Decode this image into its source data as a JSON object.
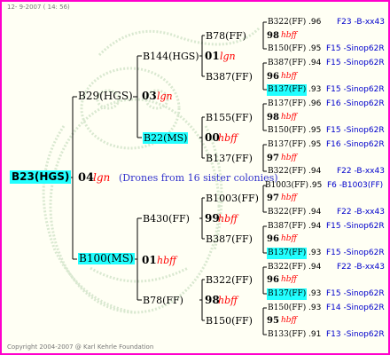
{
  "header": {
    "date": "12- 9-2007 ( 14: 56)"
  },
  "footer": {
    "copyright": "Copyright 2004-2007 @ Karl Kehrle Foundation"
  },
  "root": {
    "id": "B23(HGS)",
    "year": "04",
    "code": "lgn",
    "drones": "(Drones from 16 sister colonies)"
  },
  "gen1": {
    "top": {
      "id": "B29(HGS)",
      "year": "03",
      "code": "lgn"
    },
    "bottom": {
      "id": "B100(MS)",
      "year": "01",
      "code": "hbff"
    }
  },
  "gen2": [
    {
      "id": "B144(HGS)",
      "year": "01",
      "code": "lgn"
    },
    {
      "id": "B22(MS)",
      "year": "00",
      "code": "hbff"
    },
    {
      "id": "B430(FF)",
      "year": "99",
      "code": "hbff"
    },
    {
      "id": "B78(FF)",
      "year": "98",
      "code": "hbff"
    }
  ],
  "gen3": [
    {
      "id": "B78(FF)",
      "year": "98",
      "code": "hbff"
    },
    {
      "id": "B387(FF)",
      "year": "96",
      "code": "hbff"
    },
    {
      "id": "B155(FF)",
      "year": "98",
      "code": "hbff"
    },
    {
      "id": "B137(FF)",
      "year": "97",
      "code": "hbff"
    },
    {
      "id": "B1003(FF)",
      "year": "97",
      "code": "hbff"
    },
    {
      "id": "B387(FF)",
      "year": "96",
      "code": "hbff"
    },
    {
      "id": "B322(FF)",
      "year": "96",
      "code": "hbff"
    },
    {
      "id": "B150(FF)",
      "year": "95",
      "code": "hbff"
    }
  ],
  "gen4": [
    {
      "id": "B322(FF)",
      "score": ".96",
      "ref": "F23 -B-xx43"
    },
    {
      "id": "B150(FF)",
      "score": ".95",
      "ref": "F15 -Sinop62R"
    },
    {
      "id": "B387(FF)",
      "score": ".94",
      "ref": "F15 -Sinop62R"
    },
    {
      "id": "B137(FF)",
      "score": ".93",
      "ref": "F15 -Sinop62R"
    },
    {
      "id": "B137(FF)",
      "score": ".96",
      "ref": "F16 -Sinop62R"
    },
    {
      "id": "B150(FF)",
      "score": ".95",
      "ref": "F15 -Sinop62R"
    },
    {
      "id": "B137(FF)",
      "score": ".95",
      "ref": "F16 -Sinop62R"
    },
    {
      "id": "B322(FF)",
      "score": ".94",
      "ref": "F22 -B-xx43"
    },
    {
      "id": "B1003(FF)",
      "score": ".95",
      "ref": "F6 -B1003(FF)"
    },
    {
      "id": "B322(FF)",
      "score": ".94",
      "ref": "F22 -B-xx43"
    },
    {
      "id": "B387(FF)",
      "score": ".94",
      "ref": "F15 -Sinop62R"
    },
    {
      "id": "B137(FF)",
      "score": ".93",
      "ref": "F15 -Sinop62R"
    },
    {
      "id": "B322(FF)",
      "score": ".94",
      "ref": "F22 -B-xx43"
    },
    {
      "id": "B137(FF)",
      "score": ".93",
      "ref": "F15 -Sinop62R"
    },
    {
      "id": "B150(FF)",
      "score": ".93",
      "ref": "F14 -Sinop62R"
    },
    {
      "id": "B133(FF)",
      "score": ".91",
      "ref": "F13 -Sinop62R"
    }
  ],
  "colors": {
    "frame": "#ff00cc",
    "highlight": "#22ffff",
    "year_code": "#ff0000",
    "reference": "#0000cc",
    "drones": "#3333cc"
  }
}
